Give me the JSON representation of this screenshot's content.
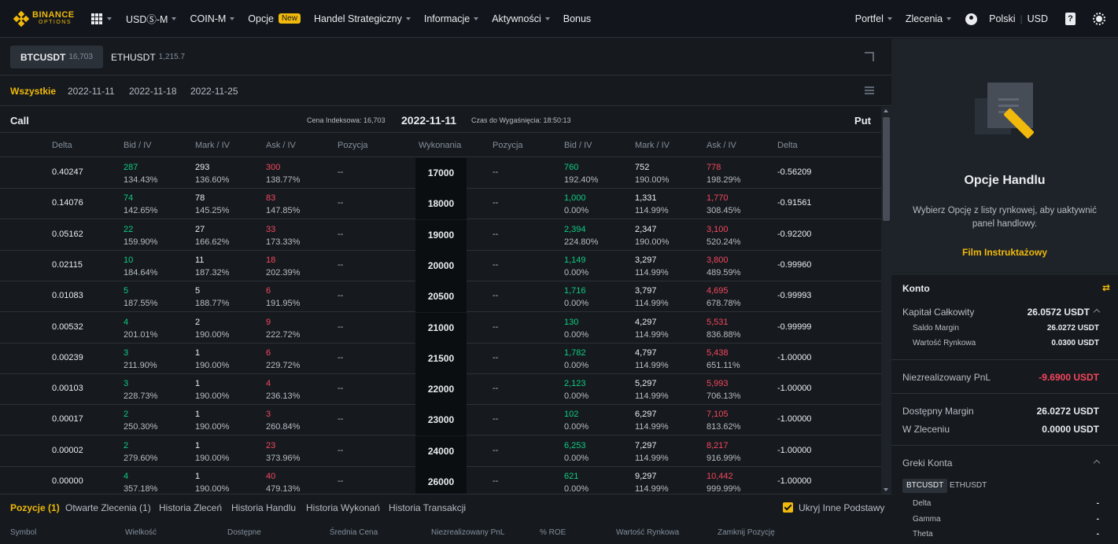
{
  "brand": {
    "line1": "BINANCE",
    "line2": "OPTIONS",
    "color": "#f0b90b"
  },
  "nav": {
    "items": [
      {
        "label": "USDⓈ-M",
        "caret": true
      },
      {
        "label": "COIN-M",
        "caret": true
      },
      {
        "label": "Opcje",
        "badge": "New"
      },
      {
        "label": "Handel Strategiczny",
        "caret": true
      },
      {
        "label": "Informacje",
        "caret": true
      },
      {
        "label": "Aktywności",
        "caret": true
      },
      {
        "label": "Bonus"
      }
    ],
    "right": {
      "wallet": "Portfel",
      "orders": "Zlecenia",
      "language": "Polski",
      "currency": "USD",
      "doc_glyph": "?"
    }
  },
  "underlyings": [
    {
      "symbol": "BTCUSDT",
      "price": "16,703",
      "active": true
    },
    {
      "symbol": "ETHUSDT",
      "price": "1,215.7",
      "active": false
    }
  ],
  "dates": [
    "Wszystkie",
    "2022-11-11",
    "2022-11-18",
    "2022-11-25"
  ],
  "chain": {
    "call_label": "Call",
    "put_label": "Put",
    "index_price": "Cena Indeksowa: 16,703",
    "expiry": "2022-11-11",
    "time_to_expiry": "Czas do Wygaśnięcia: 18:50:13"
  },
  "columns": {
    "call_delta": "Delta",
    "call_bid": "Bid / IV",
    "call_mark": "Mark / IV",
    "call_ask": "Ask / IV",
    "call_position": "Pozycja",
    "strike": "Wykonania",
    "put_position": "Pozycja",
    "put_bid": "Bid / IV",
    "put_mark": "Mark / IV",
    "put_ask": "Ask / IV",
    "put_delta": "Delta"
  },
  "rows": [
    {
      "strike": "17000",
      "call": {
        "delta": "0.40247",
        "bid": "287",
        "bid_iv": "134.43%",
        "mark": "293",
        "mark_iv": "136.60%",
        "ask": "300",
        "ask_iv": "138.77%",
        "pos": "--"
      },
      "put": {
        "pos": "--",
        "bid": "760",
        "bid_iv": "192.40%",
        "mark": "752",
        "mark_iv": "190.00%",
        "ask": "778",
        "ask_iv": "198.29%",
        "delta": "-0.56209"
      }
    },
    {
      "strike": "18000",
      "call": {
        "delta": "0.14076",
        "bid": "74",
        "bid_iv": "142.65%",
        "mark": "78",
        "mark_iv": "145.25%",
        "ask": "83",
        "ask_iv": "147.85%",
        "pos": "--"
      },
      "put": {
        "pos": "--",
        "bid": "1,000",
        "bid_iv": "0.00%",
        "mark": "1,331",
        "mark_iv": "114.99%",
        "ask": "1,770",
        "ask_iv": "308.45%",
        "delta": "-0.91561"
      }
    },
    {
      "strike": "19000",
      "call": {
        "delta": "0.05162",
        "bid": "22",
        "bid_iv": "159.90%",
        "mark": "27",
        "mark_iv": "166.62%",
        "ask": "33",
        "ask_iv": "173.33%",
        "pos": "--"
      },
      "put": {
        "pos": "--",
        "bid": "2,394",
        "bid_iv": "224.80%",
        "mark": "2,347",
        "mark_iv": "190.00%",
        "ask": "3,100",
        "ask_iv": "520.24%",
        "delta": "-0.92200"
      }
    },
    {
      "strike": "20000",
      "call": {
        "delta": "0.02115",
        "bid": "10",
        "bid_iv": "184.64%",
        "mark": "11",
        "mark_iv": "187.32%",
        "ask": "18",
        "ask_iv": "202.39%",
        "pos": "--"
      },
      "put": {
        "pos": "--",
        "bid": "1,149",
        "bid_iv": "0.00%",
        "mark": "3,297",
        "mark_iv": "114.99%",
        "ask": "3,800",
        "ask_iv": "489.59%",
        "delta": "-0.99960"
      }
    },
    {
      "strike": "20500",
      "call": {
        "delta": "0.01083",
        "bid": "5",
        "bid_iv": "187.55%",
        "mark": "5",
        "mark_iv": "188.77%",
        "ask": "6",
        "ask_iv": "191.95%",
        "pos": "--"
      },
      "put": {
        "pos": "--",
        "bid": "1,716",
        "bid_iv": "0.00%",
        "mark": "3,797",
        "mark_iv": "114.99%",
        "ask": "4,695",
        "ask_iv": "678.78%",
        "delta": "-0.99993"
      }
    },
    {
      "strike": "21000",
      "call": {
        "delta": "0.00532",
        "bid": "4",
        "bid_iv": "201.01%",
        "mark": "2",
        "mark_iv": "190.00%",
        "ask": "9",
        "ask_iv": "222.72%",
        "pos": "--"
      },
      "put": {
        "pos": "--",
        "bid": "130",
        "bid_iv": "0.00%",
        "mark": "4,297",
        "mark_iv": "114.99%",
        "ask": "5,531",
        "ask_iv": "836.88%",
        "delta": "-0.99999"
      }
    },
    {
      "strike": "21500",
      "call": {
        "delta": "0.00239",
        "bid": "3",
        "bid_iv": "211.90%",
        "mark": "1",
        "mark_iv": "190.00%",
        "ask": "6",
        "ask_iv": "229.72%",
        "pos": "--"
      },
      "put": {
        "pos": "--",
        "bid": "1,782",
        "bid_iv": "0.00%",
        "mark": "4,797",
        "mark_iv": "114.99%",
        "ask": "5,438",
        "ask_iv": "651.11%",
        "delta": "-1.00000"
      }
    },
    {
      "strike": "22000",
      "call": {
        "delta": "0.00103",
        "bid": "3",
        "bid_iv": "228.73%",
        "mark": "1",
        "mark_iv": "190.00%",
        "ask": "4",
        "ask_iv": "236.13%",
        "pos": "--"
      },
      "put": {
        "pos": "--",
        "bid": "2,123",
        "bid_iv": "0.00%",
        "mark": "5,297",
        "mark_iv": "114.99%",
        "ask": "5,993",
        "ask_iv": "706.13%",
        "delta": "-1.00000"
      }
    },
    {
      "strike": "23000",
      "call": {
        "delta": "0.00017",
        "bid": "2",
        "bid_iv": "250.30%",
        "mark": "1",
        "mark_iv": "190.00%",
        "ask": "3",
        "ask_iv": "260.84%",
        "pos": "--"
      },
      "put": {
        "pos": "--",
        "bid": "102",
        "bid_iv": "0.00%",
        "mark": "6,297",
        "mark_iv": "114.99%",
        "ask": "7,105",
        "ask_iv": "813.62%",
        "delta": "-1.00000"
      }
    },
    {
      "strike": "24000",
      "call": {
        "delta": "0.00002",
        "bid": "2",
        "bid_iv": "279.60%",
        "mark": "1",
        "mark_iv": "190.00%",
        "ask": "23",
        "ask_iv": "373.96%",
        "pos": "--"
      },
      "put": {
        "pos": "--",
        "bid": "6,253",
        "bid_iv": "0.00%",
        "mark": "7,297",
        "mark_iv": "114.99%",
        "ask": "8,217",
        "ask_iv": "916.99%",
        "delta": "-1.00000"
      }
    },
    {
      "strike": "26000",
      "call": {
        "delta": "0.00000",
        "bid": "4",
        "bid_iv": "357.18%",
        "mark": "1",
        "mark_iv": "190.00%",
        "ask": "40",
        "ask_iv": "479.13%",
        "pos": "--"
      },
      "put": {
        "pos": "--",
        "bid": "621",
        "bid_iv": "0.00%",
        "mark": "9,297",
        "mark_iv": "114.99%",
        "ask": "10,442",
        "ask_iv": "999.99%",
        "delta": "-1.00000"
      }
    }
  ],
  "bottom": {
    "tabs": [
      "Pozycje (1)",
      "Otwarte Zlecenia (1)",
      "Historia Zleceń",
      "Historia Handlu",
      "Historia Wykonań",
      "Historia Transakcji"
    ],
    "hide_others_label": "Ukryj Inne Podstawy",
    "hide_others_checked": true,
    "columns": [
      "Symbol",
      "Wielkość",
      "Dostępne",
      "Średnia Cena",
      "Niezrealizowany PnL",
      "% ROE",
      "Wartość Rynkowa",
      "Zamknij Pozycję"
    ]
  },
  "panel": {
    "title": "Opcje Handlu",
    "description": "Wybierz Opcję z listy rynkowej, aby uaktywnić panel handlowy.",
    "link": "Film Instruktażowy"
  },
  "account": {
    "title": "Konto",
    "total_capital_label": "Kapitał Całkowity",
    "total_capital": "26.0572 USDT",
    "margin_balance_label": "Saldo Margin",
    "margin_balance": "26.0272 USDT",
    "market_value_label": "Wartość Rynkowa",
    "market_value": "0.0300 USDT",
    "unrealized_label": "Niezrealizowany PnL",
    "unrealized": "-9.6900 USDT",
    "available_margin_label": "Dostępny Margin",
    "available_margin": "26.0272 USDT",
    "in_order_label": "W Zleceniu",
    "in_order": "0.0000 USDT",
    "greeks_title": "Greki Konta",
    "greeks_tabs": [
      "BTCUSDT",
      "ETHUSDT"
    ],
    "greeks": [
      {
        "label": "Delta",
        "value": "-"
      },
      {
        "label": "Gamma",
        "value": "-"
      },
      {
        "label": "Theta",
        "value": "-"
      }
    ]
  },
  "colors": {
    "accent": "#f0b90b",
    "bid": "#0ecb81",
    "ask": "#f6465d",
    "background": "#161a1e"
  }
}
